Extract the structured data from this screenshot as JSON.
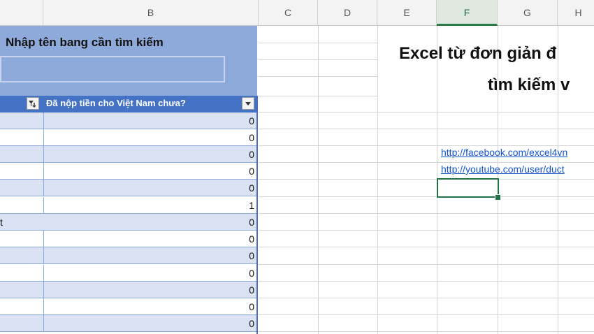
{
  "columns": [
    {
      "id": "blank",
      "label": ""
    },
    {
      "id": "B",
      "label": "B"
    },
    {
      "id": "C",
      "label": "C"
    },
    {
      "id": "D",
      "label": "D"
    },
    {
      "id": "E",
      "label": "E"
    },
    {
      "id": "F",
      "label": "F",
      "selected": true
    },
    {
      "id": "G",
      "label": "G"
    },
    {
      "id": "H",
      "label": "H"
    }
  ],
  "search_panel": {
    "title": "Nhập tên bang cần tìm kiếm",
    "input_value": ""
  },
  "table": {
    "header_label": "Đã nộp tiền cho Việt Nam chưa?",
    "rows": [
      {
        "a": "",
        "value": "0"
      },
      {
        "a": "",
        "value": "0"
      },
      {
        "a": "",
        "value": "0"
      },
      {
        "a": "",
        "value": "0"
      },
      {
        "a": "",
        "value": "0"
      },
      {
        "a": "",
        "value": "1"
      },
      {
        "a": "t",
        "value": "0"
      },
      {
        "a": "",
        "value": "0"
      },
      {
        "a": "",
        "value": "0"
      },
      {
        "a": "",
        "value": "0"
      },
      {
        "a": "",
        "value": "0"
      },
      {
        "a": "",
        "value": "0"
      },
      {
        "a": "",
        "value": "0"
      }
    ]
  },
  "banner": {
    "line1": "Excel từ đơn giản đ",
    "line2": "tìm kiếm v"
  },
  "links": {
    "facebook": "http://facebook.com/excel4vn",
    "youtube": "http://youtube.com/user/duct"
  },
  "colors": {
    "panel_bg": "#8eaadb",
    "header_bg": "#4472c4",
    "band_bg": "#d9e1f2",
    "active_border": "#217346",
    "link": "#1155cc"
  }
}
